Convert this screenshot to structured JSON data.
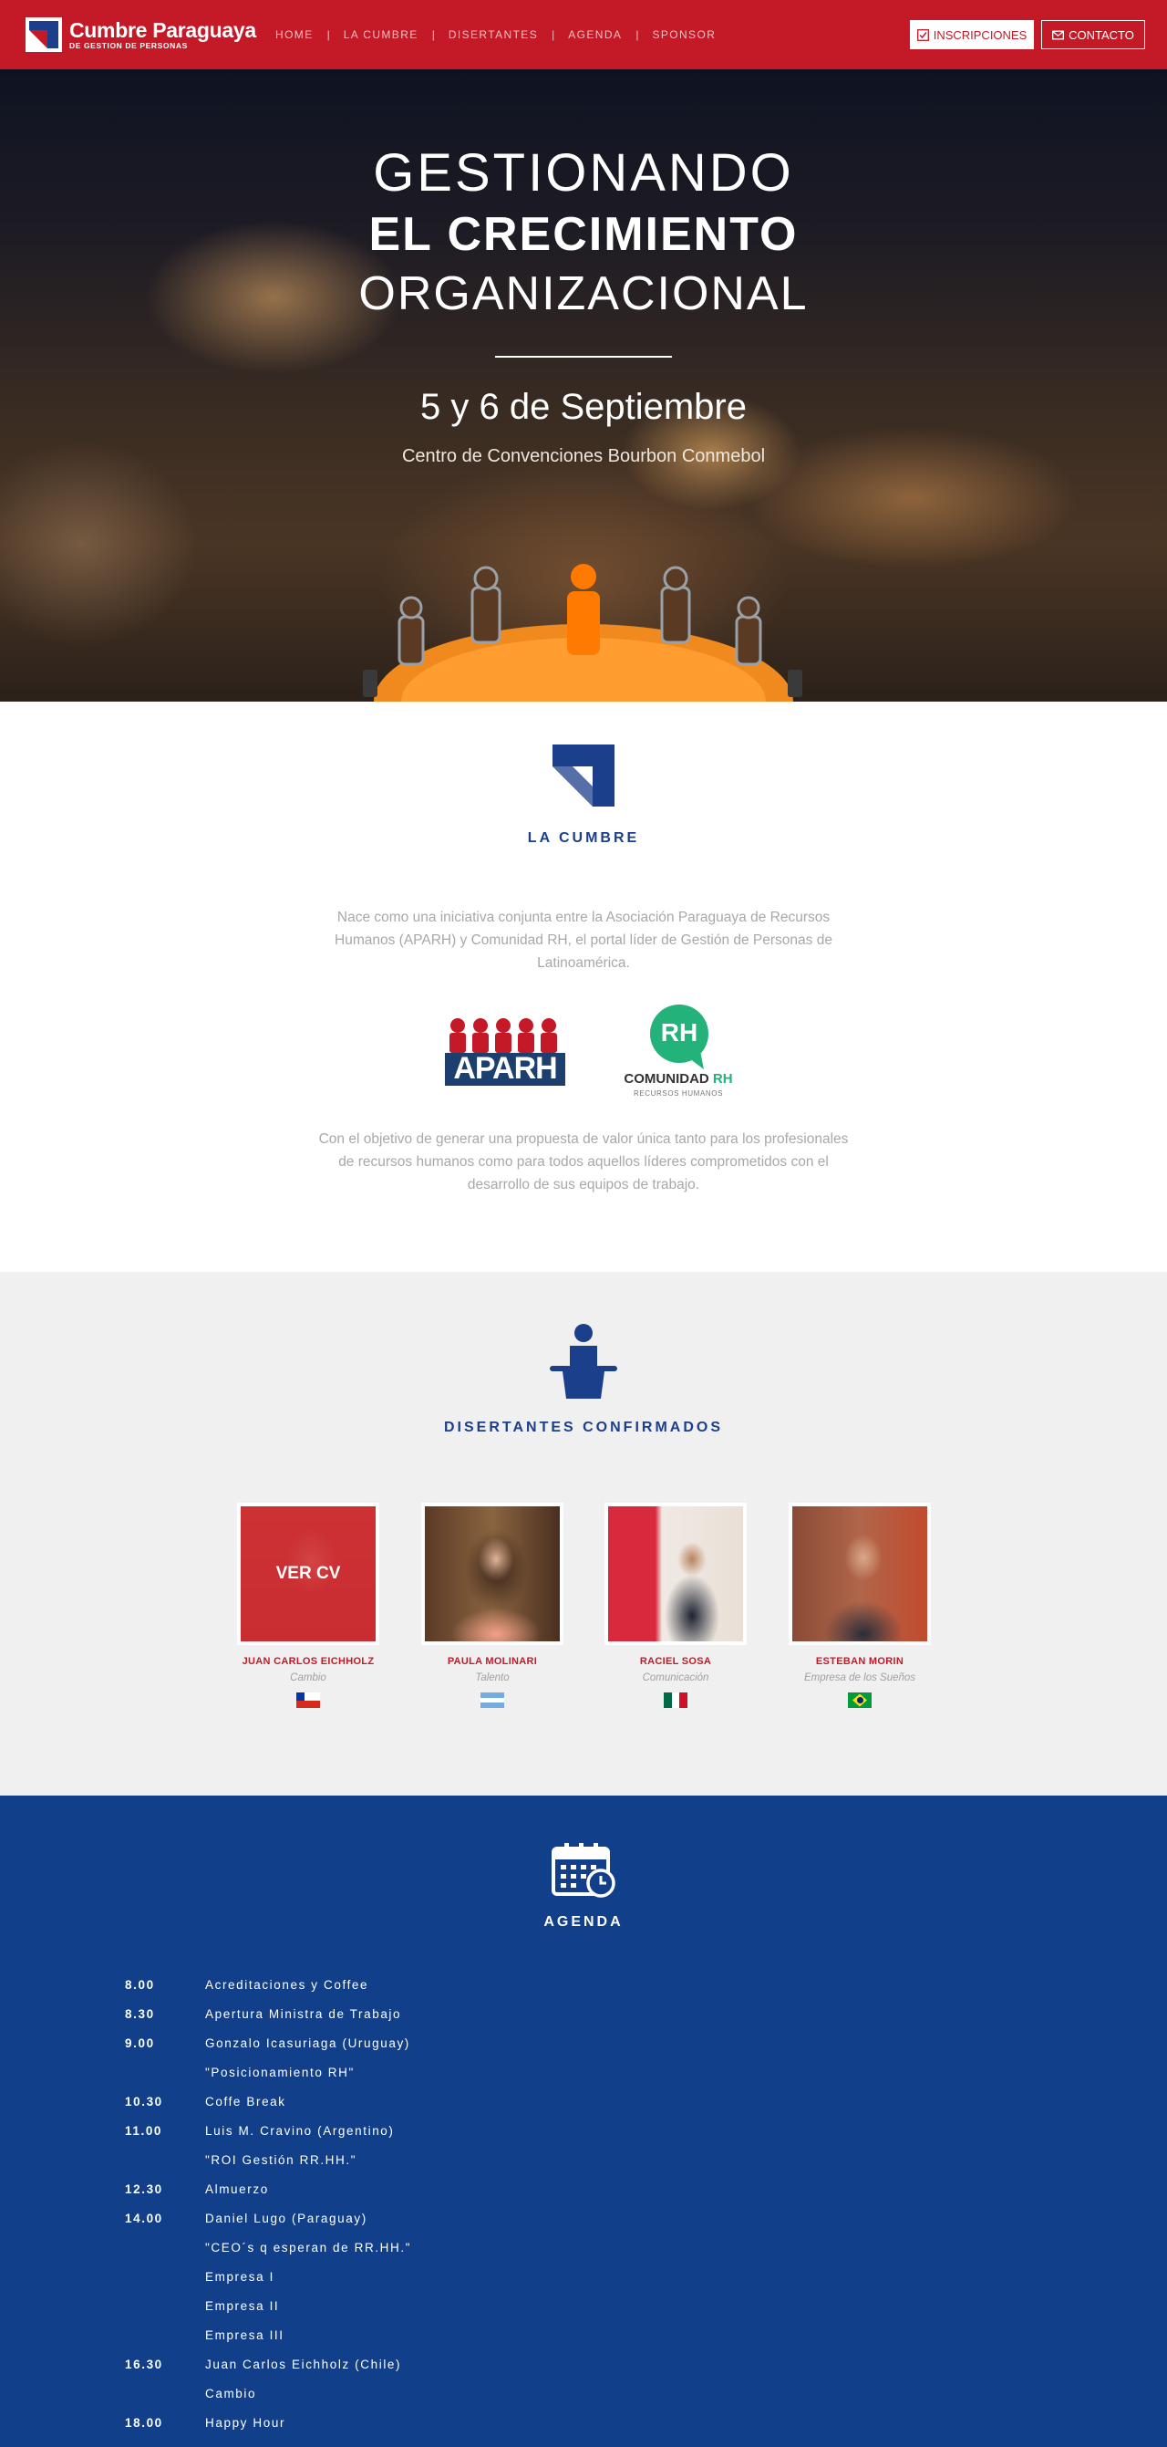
{
  "brand": {
    "title": "Cumbre Paraguaya",
    "subtitle": "DE GESTION DE PERSONAS"
  },
  "nav": {
    "items": [
      "HOME",
      "LA CUMBRE",
      "DISERTANTES",
      "AGENDA",
      "SPONSOR"
    ],
    "separator": "|"
  },
  "actions": {
    "register_label": "INSCRIPCIONES",
    "contact_label": "CONTACTO"
  },
  "hero": {
    "line1": "GESTIONANDO",
    "line2": "EL CRECIMIENTO",
    "line3": "ORGANIZACIONAL",
    "date": "5 y 6 de Septiembre",
    "venue": "Centro de Convenciones Bourbon Conmebol"
  },
  "cumbre": {
    "title": "LA CUMBRE",
    "intro": "Nace como una iniciativa conjunta entre la Asociación Paraguaya de Recursos Humanos (APARH) y Comunidad RH, el portal líder de Gestión de Personas de Latinoamérica.",
    "outro": "Con el objetivo de generar una propuesta de valor única tanto para los profesionales de recursos humanos como para todos aquellos líderes comprometidos con el desarrollo de sus equipos de trabajo.",
    "logo_aparh": "APARH",
    "logo_rh_badge": "RH",
    "logo_rh_name": "COMUNIDAD",
    "logo_rh_name2": "RH",
    "logo_rh_sub": "RECURSOS HUMANOS"
  },
  "disertantes": {
    "title": "DISERTANTES CONFIRMADOS",
    "cv_label": "VER CV",
    "speakers": [
      {
        "name": "JUAN CARLOS EICHHOLZ",
        "topic": "Cambio",
        "flag": "chile-flag"
      },
      {
        "name": "PAULA MOLINARI",
        "topic": "Talento",
        "flag": "argentina-flag"
      },
      {
        "name": "RACIEL SOSA",
        "topic": "Comunicación",
        "flag": "mexico-flag"
      },
      {
        "name": "ESTEBAN MORIN",
        "topic": "Empresa de los Sueños",
        "flag": "brazil-flag"
      }
    ]
  },
  "agenda": {
    "title": "AGENDA",
    "rows": [
      {
        "time": "8.00",
        "item": "Acreditaciones y Coffee"
      },
      {
        "time": "8.30",
        "item": "Apertura Ministra de Trabajo"
      },
      {
        "time": "9.00",
        "item": "Gonzalo Icasuriaga (Uruguay)"
      },
      {
        "time": "",
        "item": "\"Posicionamiento RH\""
      },
      {
        "time": "10.30",
        "item": "Coffe Break"
      },
      {
        "time": "11.00",
        "item": "Luis M. Cravino (Argentino)"
      },
      {
        "time": "",
        "item": "\"ROI Gestión RR.HH.\""
      },
      {
        "time": "12.30",
        "item": "Almuerzo"
      },
      {
        "time": "14.00",
        "item": "Daniel Lugo (Paraguay)"
      },
      {
        "time": "",
        "item": "\"CEO´s q esperan de RR.HH.\""
      },
      {
        "time": "",
        "item": "Empresa I"
      },
      {
        "time": "",
        "item": "Empresa II"
      },
      {
        "time": "",
        "item": "Empresa III"
      },
      {
        "time": "16.30",
        "item": "Juan Carlos Eichholz (Chile)"
      },
      {
        "time": "",
        "item": "Cambio"
      },
      {
        "time": "18.00",
        "item": "Happy Hour"
      }
    ]
  },
  "colors": {
    "brand_red": "#c41a27",
    "brand_blue": "#1c3f8c",
    "agenda_bg": "#123f8a",
    "gray_bg": "#f0f0f0"
  }
}
